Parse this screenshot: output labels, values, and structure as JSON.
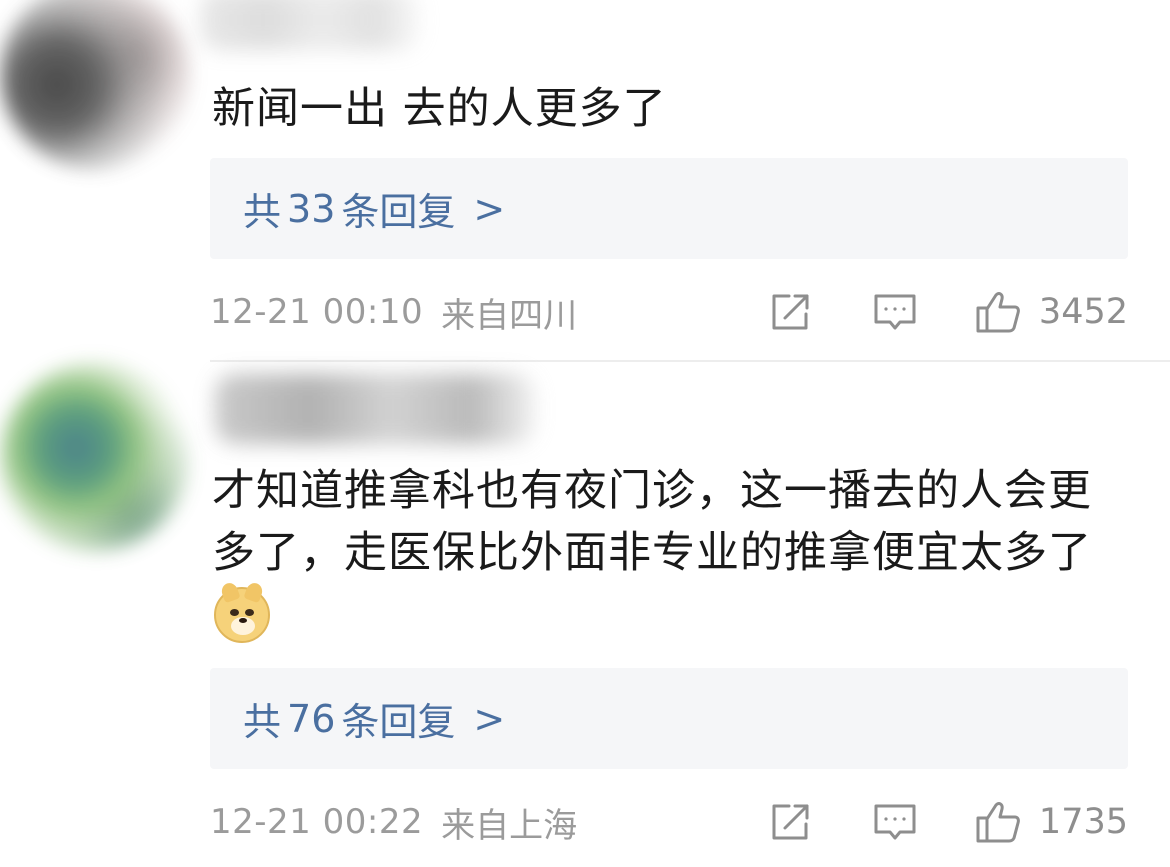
{
  "comments": [
    {
      "text": "新闻一出 去的人更多了",
      "replies": {
        "prefix": "共",
        "count": "33",
        "suffix": "条回复",
        "arrow": ">"
      },
      "time": "12-21 00:10",
      "location": "来自四川",
      "likes": "3452"
    },
    {
      "text": "才知道推拿科也有夜门诊，这一播去的人会更多了，走医保比外面非专业的推拿便宜太多了",
      "emoji": "doge-emoji",
      "replies": {
        "prefix": "共",
        "count": "76",
        "suffix": "条回复",
        "arrow": ">"
      },
      "time": "12-21 00:22",
      "location": "来自上海",
      "likes": "1735"
    }
  ],
  "icons": {
    "share": "share-icon",
    "comment": "comment-icon",
    "like": "thumbs-up-icon"
  },
  "colors": {
    "reply_link": "#4a6fa0",
    "meta_text": "#9b9b9b",
    "reply_bg": "#f5f6f8"
  }
}
